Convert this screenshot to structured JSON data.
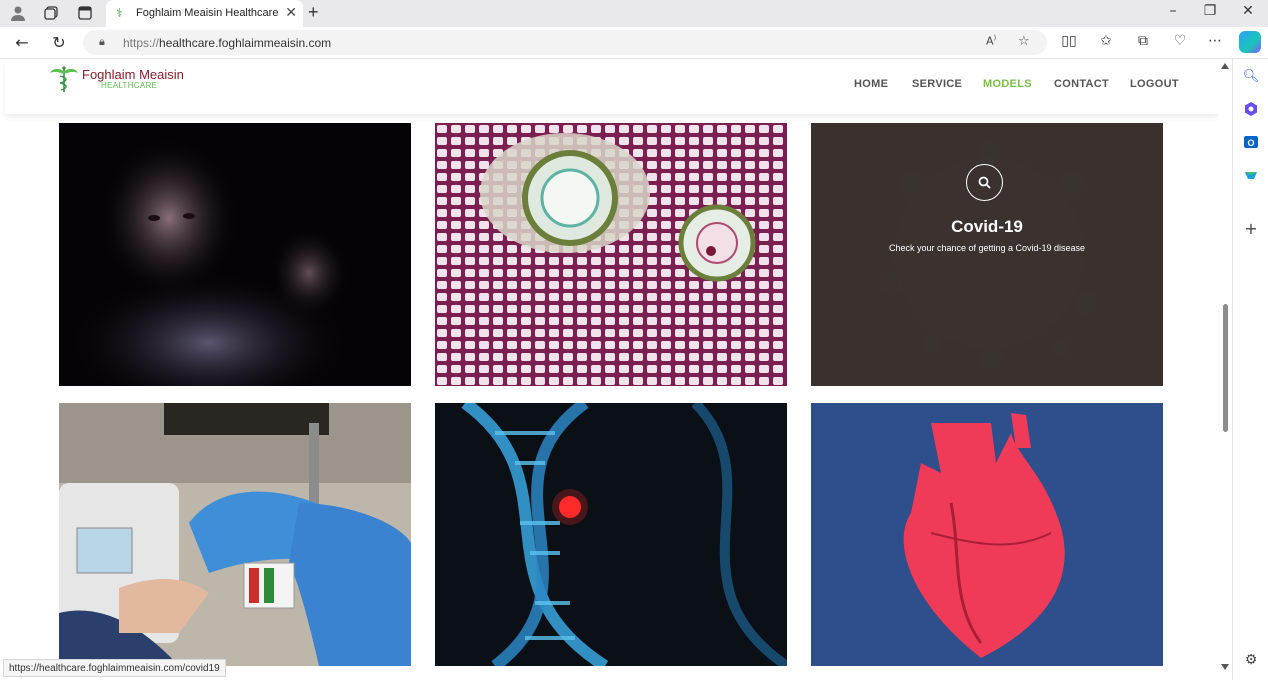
{
  "browser": {
    "tab_title": "Foghlaim Meaisin Healthcare",
    "url_scheme": "https://",
    "url_host": "healthcare.foghlaimmeaisin.com",
    "status_url": "https://healthcare.foghlaimmeaisin.com/covid19"
  },
  "site": {
    "brand_name": "Foghlaim Meaisin",
    "brand_sub": "HEALTHCARE",
    "nav": [
      {
        "label": "HOME",
        "active": false
      },
      {
        "label": "SERVICE",
        "active": false
      },
      {
        "label": "MODELS",
        "active": true
      },
      {
        "label": "CONTACT",
        "active": false
      },
      {
        "label": "LOGOUT",
        "active": false
      }
    ],
    "accent_color": "#7ac043",
    "brand_color": "#8a1c2b"
  },
  "models": [
    {
      "name": "dark-portrait",
      "title": "",
      "description": ""
    },
    {
      "name": "cell-microscopy",
      "title": "",
      "description": ""
    },
    {
      "name": "covid",
      "title": "Covid-19",
      "description": "Check your chance of getting a Covid-19 disease"
    },
    {
      "name": "lab-test",
      "title": "",
      "description": ""
    },
    {
      "name": "dna",
      "title": "",
      "description": ""
    },
    {
      "name": "heart",
      "title": "",
      "description": ""
    }
  ]
}
